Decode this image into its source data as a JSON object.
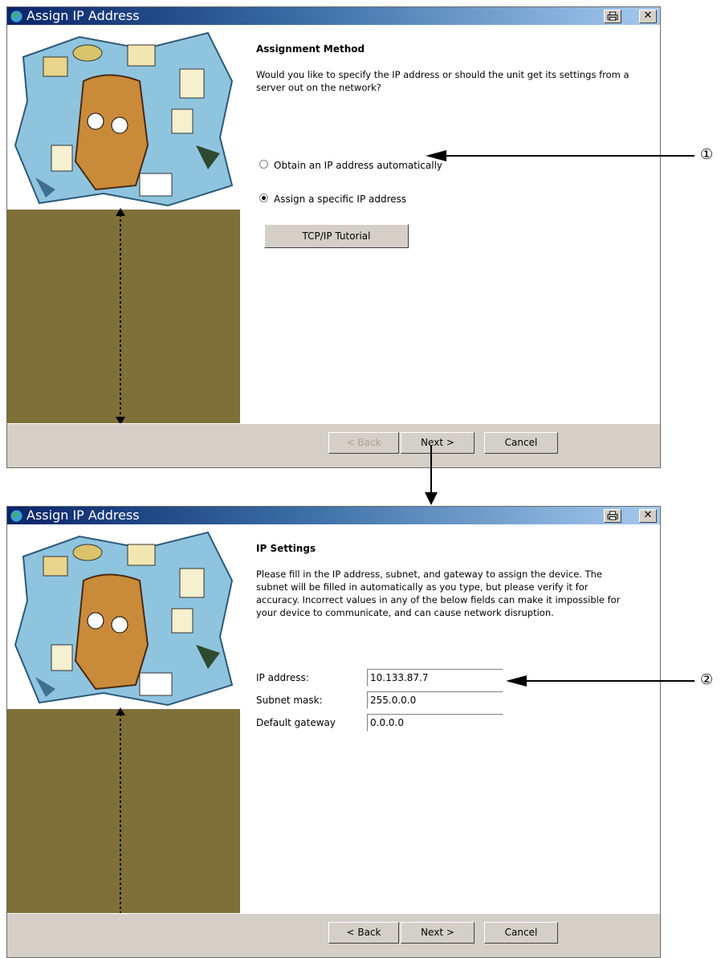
{
  "window1": {
    "title": "Assign IP Address",
    "heading": "Assignment Method",
    "description": "Would you like to specify the IP address or should the unit get its settings from a server out on the network?",
    "options": [
      {
        "label": "Obtain an IP address automatically",
        "checked": false
      },
      {
        "label": "Assign a specific IP address",
        "checked": true
      }
    ],
    "tutorial_button": "TCP/IP Tutorial",
    "back_label": "< Back",
    "next_label": "Next >",
    "cancel_label": "Cancel"
  },
  "window2": {
    "title": "Assign IP Address",
    "heading": "IP Settings",
    "description": "Please fill in the IP address, subnet, and gateway to assign the device. The subnet will be filled in automatically as you type, but please verify it for accuracy.  Incorrect values in any of the below fields can make it impossible for your device to communicate, and can cause network disruption.",
    "fields": [
      {
        "label": "IP address:",
        "value": "10.133.87.7"
      },
      {
        "label": "Subnet mask:",
        "value": "255.0.0.0"
      },
      {
        "label": "Default gateway",
        "value": "0.0.0.0"
      }
    ],
    "back_label": "< Back",
    "next_label": "Next >",
    "cancel_label": "Cancel"
  },
  "annotations": {
    "callout_1": "①",
    "callout_2": "②"
  },
  "icons": {
    "title_icon": "globe-icon",
    "print_icon": "printer-icon",
    "close_icon": "close-icon"
  },
  "colors": {
    "panel_bg": "#7e7038",
    "title_gradient_start": "#0a246a",
    "title_gradient_end": "#a6caf0",
    "dialog_face": "#d4d0c8"
  }
}
